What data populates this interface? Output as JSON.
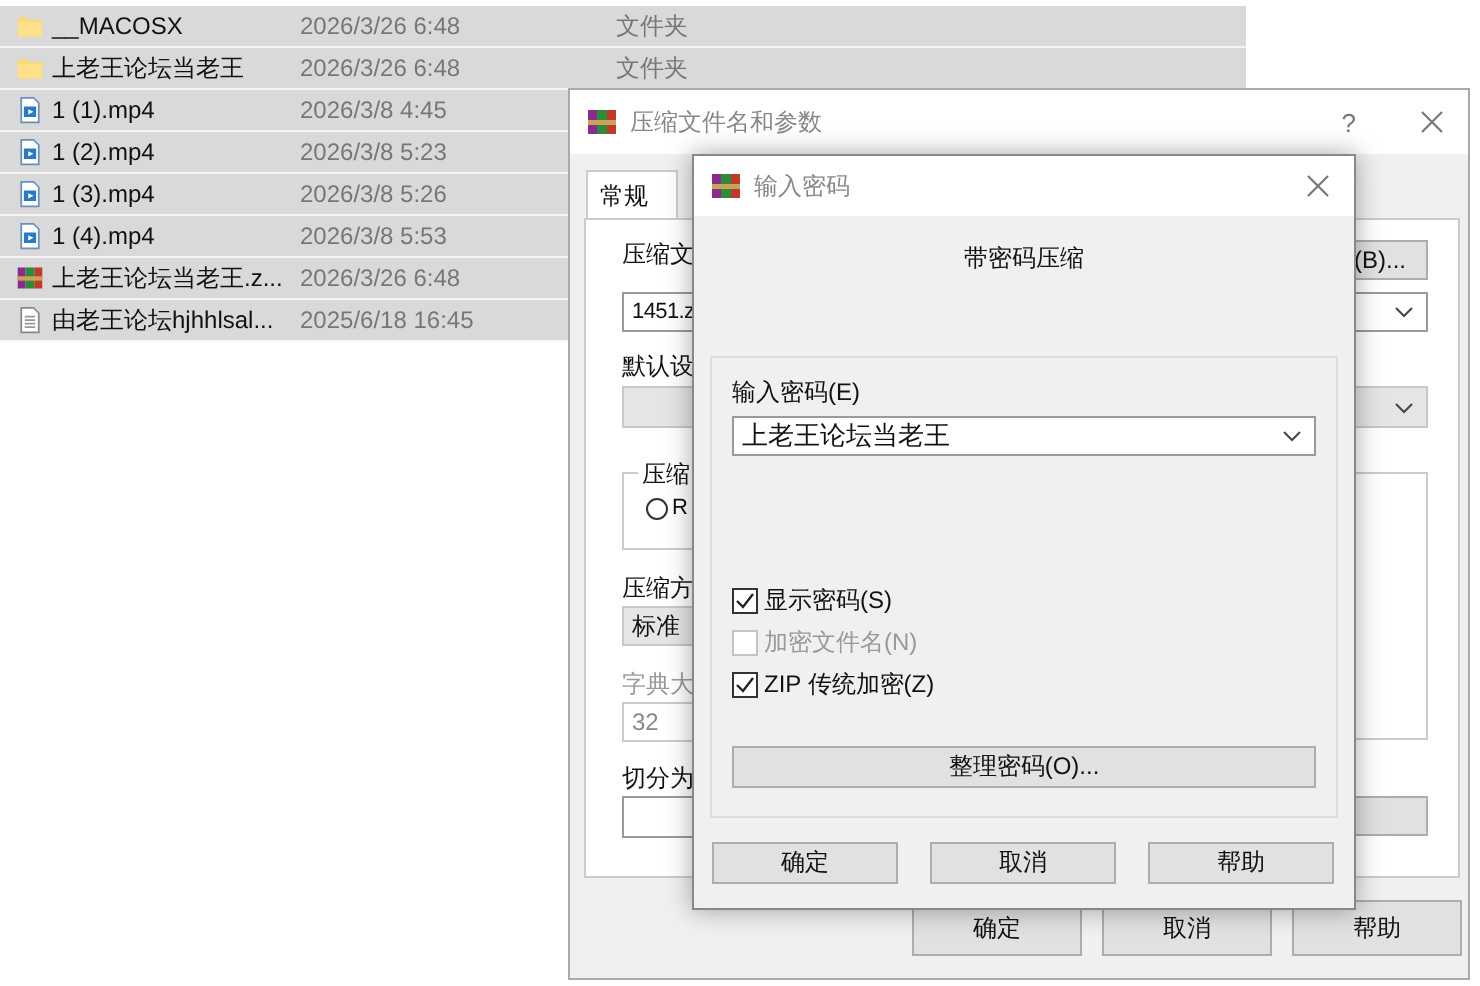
{
  "file_list": {
    "rows": [
      {
        "kind": "folder",
        "name": "__MACOSX",
        "date": "2026/3/26 6:48",
        "type": "文件夹",
        "selected": true
      },
      {
        "kind": "folder",
        "name": "上老王论坛当老王",
        "date": "2026/3/26 6:48",
        "type": "文件夹",
        "selected": true
      },
      {
        "kind": "video",
        "name": "1 (1).mp4",
        "date": "2026/3/8 4:45",
        "selected": true
      },
      {
        "kind": "video",
        "name": "1 (2).mp4",
        "date": "2026/3/8 5:23",
        "selected": true
      },
      {
        "kind": "video",
        "name": "1 (3).mp4",
        "date": "2026/3/8 5:26",
        "selected": true
      },
      {
        "kind": "video",
        "name": "1 (4).mp4",
        "date": "2026/3/8 5:53",
        "selected": true
      },
      {
        "kind": "archive",
        "name": "上老王论坛当老王.z...",
        "date": "2026/3/26 6:48",
        "selected": true
      },
      {
        "kind": "text",
        "name": "由老王论坛hjhhlsal...",
        "date": "2025/6/18 16:45",
        "selected": true
      }
    ]
  },
  "main_dialog": {
    "title": "压缩文件名和参数",
    "help": "?",
    "tabs": [
      {
        "label": "常规",
        "selected": true
      }
    ],
    "archive_label": "压缩文",
    "archive_name": "1451.z",
    "browse_button": "(B)...",
    "profile_label": "默认设",
    "format_group": "压缩",
    "format_radio": {
      "label": "R",
      "selected": false
    },
    "method_label": "压缩方",
    "method_value": "标准",
    "dict_label": "字典大",
    "dict_value": "32",
    "dict_disabled": true,
    "split_label": "切分为",
    "buttons": [
      "确定",
      "取消",
      "帮助"
    ]
  },
  "password_dialog": {
    "title": "输入密码",
    "heading": "带密码压缩",
    "password_label": "输入密码(E)",
    "password_value": "上老王论坛当老王",
    "options": [
      {
        "label": "显示密码(S)",
        "checked": true,
        "disabled": false
      },
      {
        "label": "加密文件名(N)",
        "checked": false,
        "disabled": true
      },
      {
        "label": "ZIP 传统加密(Z)",
        "checked": true,
        "disabled": false
      }
    ],
    "organize_button": "整理密码(O)...",
    "buttons": [
      "确定",
      "取消",
      "帮助"
    ]
  }
}
